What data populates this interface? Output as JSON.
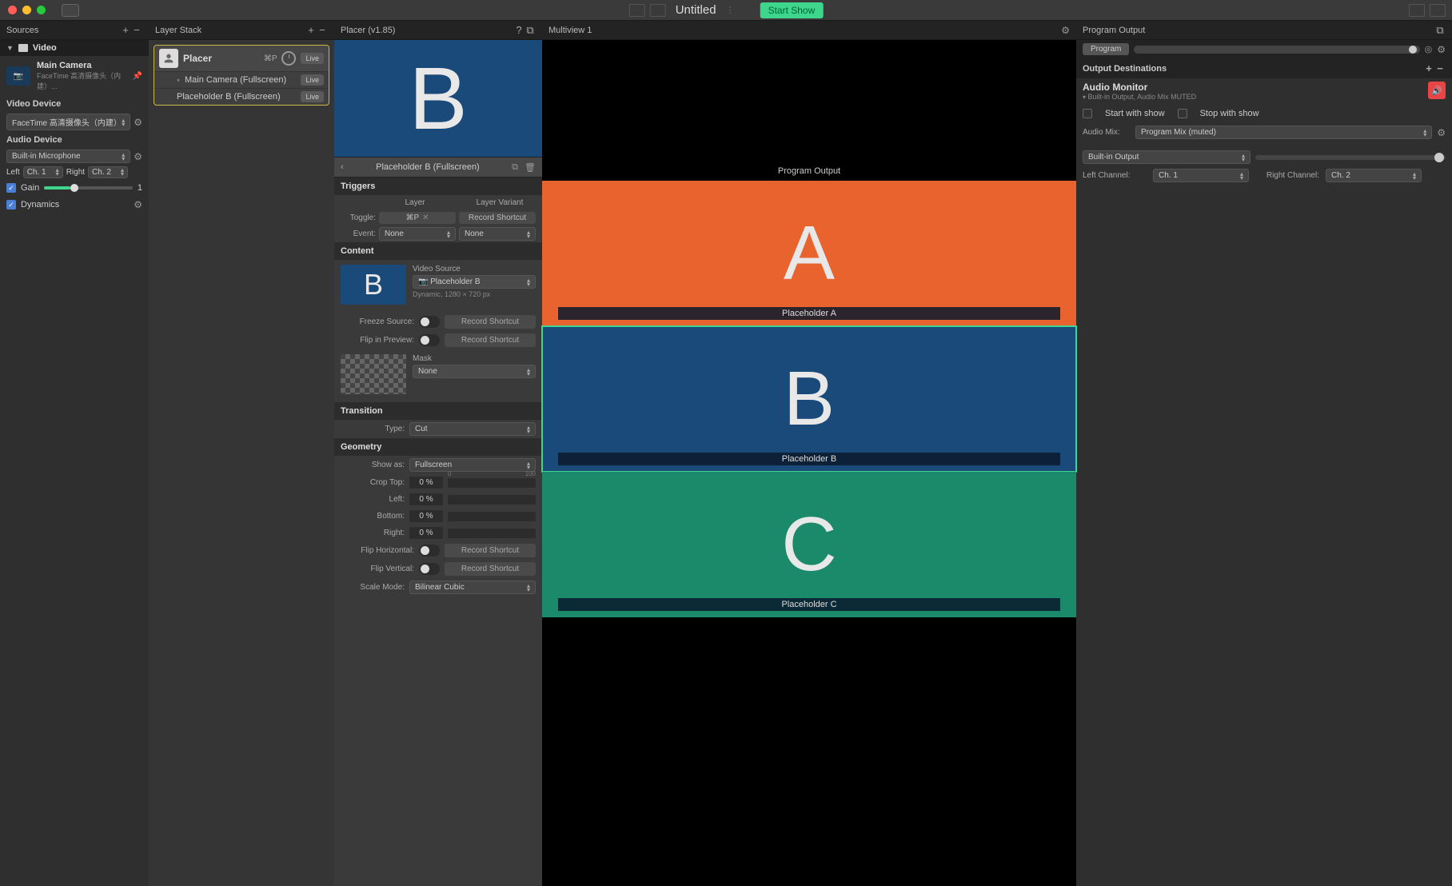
{
  "titlebar": {
    "title": "Untitled",
    "start_show": "Start Show"
  },
  "sources": {
    "header": "Sources",
    "video_section": "Video",
    "main_camera": {
      "name": "Main Camera",
      "sub": "FaceTime 高清摄像头（内建）..."
    },
    "video_device_label": "Video Device",
    "video_device_value": "FaceTime 高清摄像头（内建）",
    "audio_device_label": "Audio Device",
    "audio_device_value": "Built-in Microphone",
    "left_label": "Left",
    "left_value": "Ch. 1",
    "right_label": "Right",
    "right_value": "Ch. 2",
    "gain_label": "Gain",
    "gain_value": "1",
    "dynamics": "Dynamics"
  },
  "layers": {
    "header": "Layer Stack",
    "placer": {
      "name": "Placer",
      "shortcut": "⌘P",
      "live": "Live",
      "subs": [
        {
          "name": "Main Camera (Fullscreen)",
          "badge": "Live"
        },
        {
          "name": "Placeholder B (Fullscreen)",
          "badge": "Live"
        }
      ]
    }
  },
  "placer": {
    "header": "Placer (v1.85)",
    "preview_letter": "B",
    "crumb": "Placeholder B (Fullscreen)",
    "triggers": {
      "section": "Triggers",
      "layer_col": "Layer",
      "variant_col": "Layer Variant",
      "toggle_label": "Toggle:",
      "toggle_value": "⌘P",
      "toggle_variant": "Record Shortcut",
      "event_label": "Event:",
      "event_layer": "None",
      "event_variant": "None"
    },
    "content": {
      "section": "Content",
      "video_source_label": "Video Source",
      "video_source_value": "Placeholder B",
      "dimensions": "Dynamic, 1280 × 720 px",
      "freeze_label": "Freeze Source:",
      "freeze_rec": "Record Shortcut",
      "flip_prev_label": "Flip in Preview:",
      "flip_prev_rec": "Record Shortcut",
      "mask_label": "Mask",
      "mask_value": "None"
    },
    "transition": {
      "section": "Transition",
      "type_label": "Type:",
      "type_value": "Cut"
    },
    "geometry": {
      "section": "Geometry",
      "show_as_label": "Show as:",
      "show_as_value": "Fullscreen",
      "crop_top_label": "Crop Top:",
      "left_label": "Left:",
      "bottom_label": "Bottom:",
      "right_label": "Right:",
      "pct": "0 %",
      "tick_min": "0",
      "tick_max": "100",
      "flip_h_label": "Flip Horizontal:",
      "flip_h_rec": "Record Shortcut",
      "flip_v_label": "Flip Vertical:",
      "flip_v_rec": "Record Shortcut",
      "scale_label": "Scale Mode:",
      "scale_value": "Bilinear Cubic"
    }
  },
  "multiview": {
    "header": "Multiview 1",
    "program_output": "Program Output",
    "tiles": [
      {
        "letter": "A",
        "label": "Placeholder A",
        "color": "#e8632e",
        "selected": false
      },
      {
        "letter": "B",
        "label": "Placeholder B",
        "color": "#1a4a7a",
        "selected": true
      },
      {
        "letter": "C",
        "label": "Placeholder C",
        "color": "#1a8a6a",
        "selected": false
      }
    ]
  },
  "output": {
    "header": "Program Output",
    "program_pill": "Program",
    "dest_header": "Output Destinations",
    "audio_monitor": {
      "title": "Audio Monitor",
      "sub": "Built-in Output, Audio Mix MUTED",
      "start_with": "Start with show",
      "stop_with": "Stop with show",
      "mix_label": "Audio Mix:",
      "mix_value": "Program Mix (muted)",
      "builtin": "Built-in Output",
      "left_ch_label": "Left Channel:",
      "left_ch_value": "Ch. 1",
      "right_ch_label": "Right Channel:",
      "right_ch_value": "Ch. 2"
    }
  }
}
